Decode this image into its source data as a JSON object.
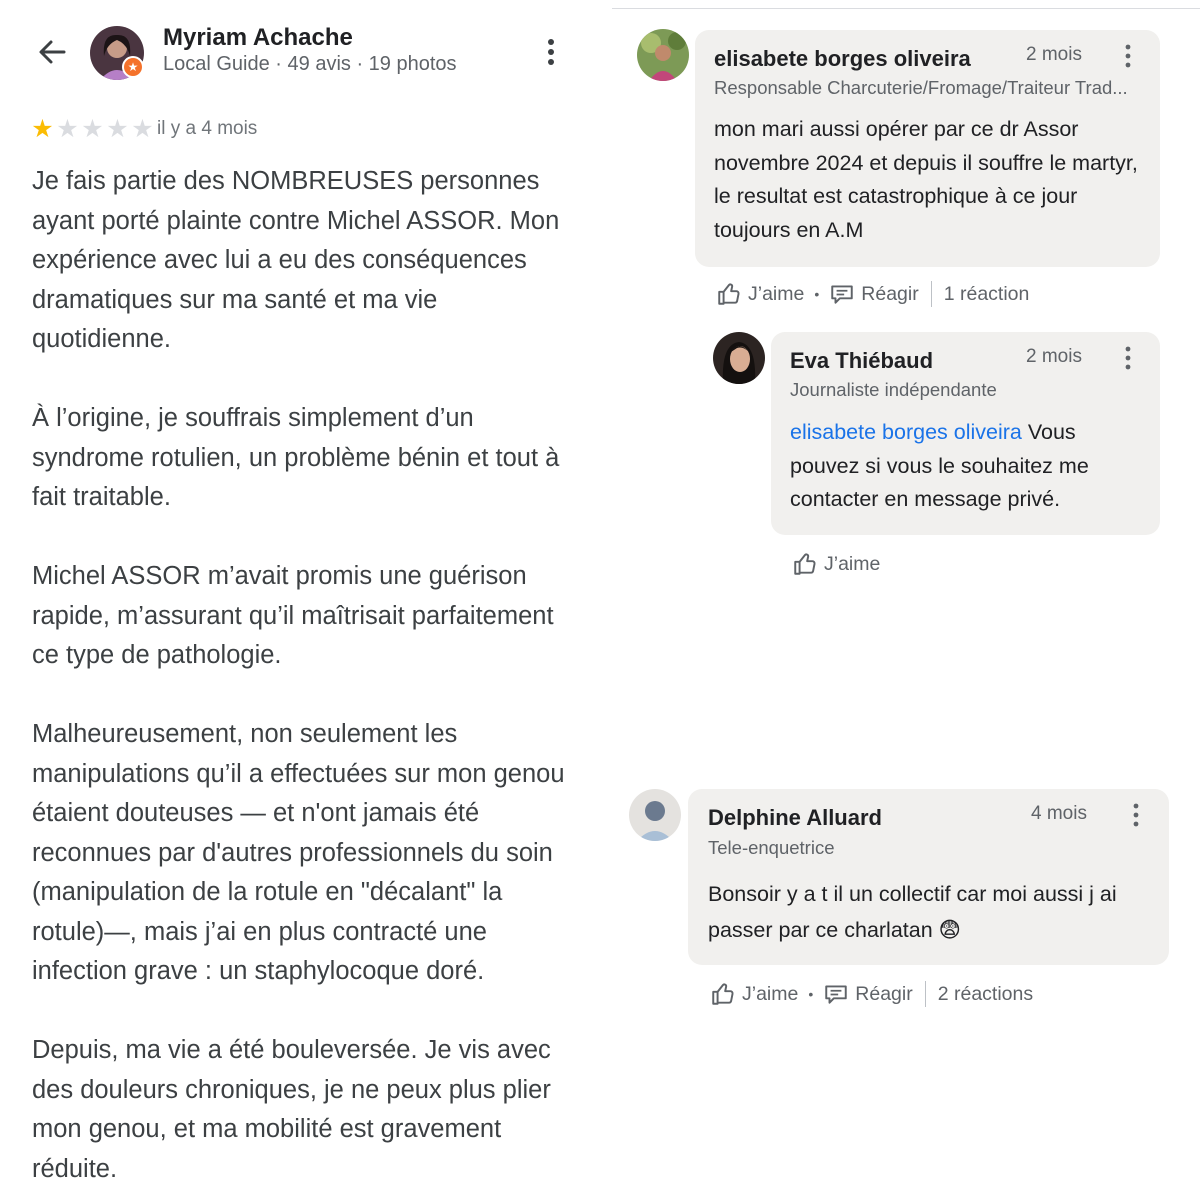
{
  "review": {
    "author": "Myriam Achache",
    "meta": "Local Guide · 49 avis · 19 photos",
    "rating": 1,
    "max_rating": 5,
    "date": "il y a 4 mois",
    "paragraphs": [
      "Je fais partie des NOMBREUSES personnes ayant porté plainte contre Michel ASSOR. Mon expérience avec lui a eu des conséquences dramatiques sur ma santé et ma vie quotidienne.",
      "À l’origine, je souffrais simplement d’un syndrome rotulien, un problème bénin et tout à fait traitable.",
      "Michel ASSOR m’avait promis une guérison rapide, m’assurant qu’il maîtrisait parfaitement ce type de pathologie.",
      "Malheureusement, non seulement les manipulations qu’il a effectuées sur mon genou étaient douteuses — et n'ont jamais été reconnues par d'autres professionnels du soin (manipulation de la rotule en \"décalant\" la rotule)—, mais j’ai en plus contracté une infection grave : un staphylocoque doré.",
      "Depuis, ma vie a été bouleversée. Je vis avec des douleurs chroniques, je ne peux plus plier mon genou, et ma mobilité est gravement réduite."
    ]
  },
  "comments": [
    {
      "name": "elisabete borges oliveira",
      "role": "Responsable Charcuterie/Fromage/Traiteur Trad...",
      "time": "2 mois",
      "text": "mon mari aussi opérer par ce dr Assor novembre 2024 et depuis il souffre le martyr, le resultat est catastrophique à ce jour toujours en A.M",
      "like_label": "J’aime",
      "react_label": "Réagir",
      "reactions": "1 réaction"
    },
    {
      "name": "Eva Thiébaud",
      "role": "Journaliste indépendante",
      "time": "2 mois",
      "mention": "elisabete borges oliveira",
      "text": " Vous pouvez si vous le souhaitez me contacter en message privé.",
      "like_label": "J’aime"
    },
    {
      "name": "Delphine Alluard",
      "role": "Tele-enquetrice",
      "time": "4 mois",
      "text": "Bonsoir y a t il un collectif car moi aussi j ai passer par ce charlatan 😨",
      "like_label": "J’aime",
      "react_label": "Réagir",
      "reactions": "2 réactions"
    }
  ],
  "colors": {
    "star_on": "#fbbc04",
    "star_off": "#dadce0",
    "mention": "#1a73e8",
    "bubble": "#f1f0ee",
    "badge": "#f4722b"
  },
  "icons": [
    "back-arrow-icon",
    "more-vert-icon",
    "star-icon",
    "thumb-up-icon",
    "comment-icon",
    "local-guide-badge-icon"
  ]
}
